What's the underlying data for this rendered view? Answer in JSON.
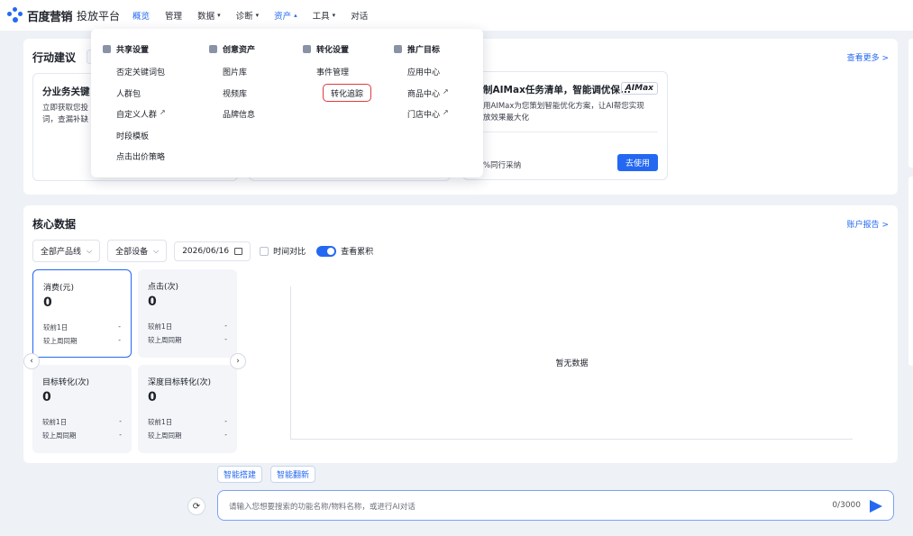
{
  "brand": {
    "name": "百度营销",
    "subtitle": "投放平台"
  },
  "nav": [
    {
      "label": "概览",
      "active": true,
      "caret": ""
    },
    {
      "label": "管理",
      "caret": ""
    },
    {
      "label": "数据",
      "caret": "▾"
    },
    {
      "label": "诊断",
      "caret": "▾"
    },
    {
      "label": "资产",
      "caret": "▴"
    },
    {
      "label": "工具",
      "caret": "▾"
    },
    {
      "label": "对话",
      "caret": ""
    }
  ],
  "suggestions": {
    "title": "行动建议",
    "more_link": "查看更多 >",
    "cards": [
      {
        "head": "分业务关键",
        "desc": "立即获取您投\n词，查漏补缺"
      },
      {
        "head": "制AIMax任务清单，智能调优保...",
        "badge": "AIMax",
        "desc": "用AIMax为您策划智能优化方案，让AI帮您实现\n放效果最大化",
        "foot": "%同行采纳",
        "button": "去使用"
      }
    ]
  },
  "core": {
    "title": "核心数据",
    "report_link": "账户报告 >",
    "filters": {
      "product": "全部产品线",
      "device": "全部设备",
      "date": "2026/06/16",
      "compare": "时间对比",
      "cumulative": "查看累积"
    },
    "metrics": [
      {
        "label": "消费(元)",
        "value": "0",
        "row1": "较前1日",
        "row1v": "-",
        "row2": "较上周同期",
        "row2v": "-"
      },
      {
        "label": "点击(次)",
        "value": "0",
        "row1": "较前1日",
        "row1v": "-",
        "row2": "较上周同期",
        "row2v": "-"
      },
      {
        "label": "目标转化(次)",
        "value": "0",
        "row1": "较前1日",
        "row1v": "-",
        "row2": "较上周同期",
        "row2v": "-"
      },
      {
        "label": "深度目标转化(次)",
        "value": "0",
        "row1": "较前1日",
        "row1v": "-",
        "row2": "较上周同期",
        "row2v": "-"
      }
    ],
    "nodata": "暂无数据"
  },
  "assistant": {
    "pills": [
      "智能搭建",
      "智能翻新"
    ],
    "placeholder": "请输入您想要搜索的功能名称/物料名称，或进行AI对话",
    "count": "0/3000"
  },
  "dropdown": {
    "columns": [
      {
        "head": "共享设置",
        "items": [
          {
            "label": "否定关键词包"
          },
          {
            "label": "人群包"
          },
          {
            "label": "自定义人群",
            "ext": true
          },
          {
            "label": "时段模板"
          },
          {
            "label": "点击出价策略"
          }
        ]
      },
      {
        "head": "创意资产",
        "items": [
          {
            "label": "图片库"
          },
          {
            "label": "视频库"
          },
          {
            "label": "品牌信息"
          }
        ]
      },
      {
        "head": "转化设置",
        "items": [
          {
            "label": "事件管理"
          },
          {
            "label": "转化追踪",
            "highlighted": true
          }
        ]
      },
      {
        "head": "推广目标",
        "items": [
          {
            "label": "应用中心"
          },
          {
            "label": "商品中心",
            "ext": true
          },
          {
            "label": "门店中心",
            "ext": true
          }
        ]
      }
    ]
  },
  "colors": {
    "accent": "#2468f2",
    "highlight": "#e03b3b"
  }
}
